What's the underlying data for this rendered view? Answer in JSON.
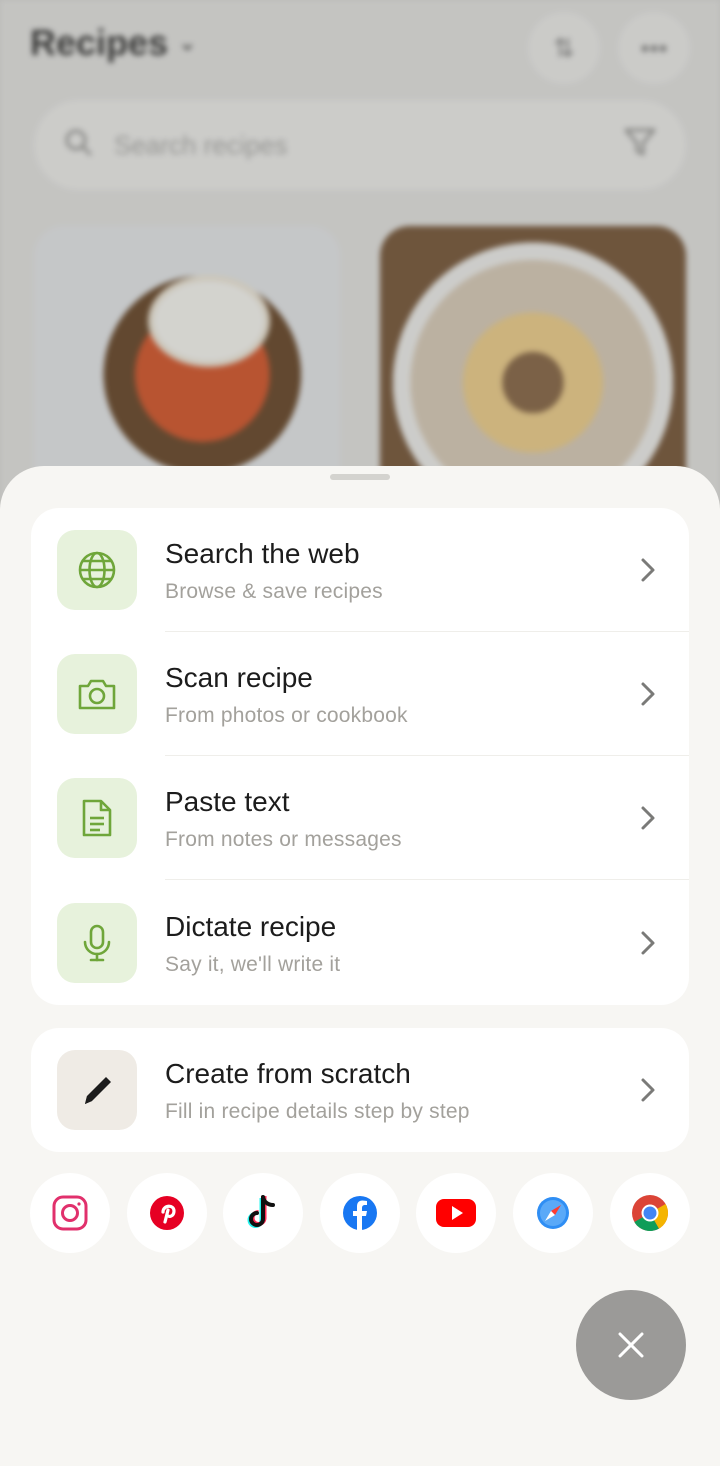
{
  "background": {
    "title": "Recipes",
    "search_placeholder": "Search recipes",
    "icons": [
      "chevron-down-icon",
      "sort-icon",
      "more-icon",
      "search-icon",
      "filter-icon"
    ]
  },
  "sheet": {
    "options": [
      {
        "title": "Search the web",
        "subtitle": "Browse & save recipes",
        "icon": "globe-icon"
      },
      {
        "title": "Scan recipe",
        "subtitle": "From photos or cookbook",
        "icon": "camera-icon"
      },
      {
        "title": "Paste text",
        "subtitle": "From notes or messages",
        "icon": "document-icon"
      },
      {
        "title": "Dictate recipe",
        "subtitle": "Say it, we'll write it",
        "icon": "microphone-icon"
      }
    ],
    "scratch": {
      "title": "Create from scratch",
      "subtitle": "Fill in recipe details step by step",
      "icon": "pencil-icon"
    },
    "sources": [
      "instagram-icon",
      "pinterest-icon",
      "tiktok-icon",
      "facebook-icon",
      "youtube-icon",
      "safari-icon",
      "chrome-icon"
    ]
  },
  "colors": {
    "accent_green": "#6fa63a",
    "tile_green": "#e7f2dc",
    "sheet_bg": "#f7f6f3",
    "close_fab": "#9b9a98"
  }
}
